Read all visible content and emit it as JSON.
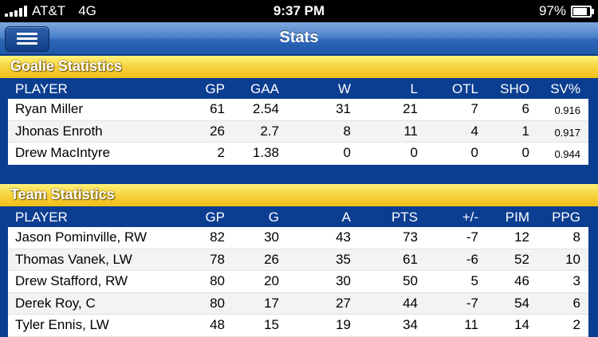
{
  "status": {
    "carrier": "AT&T",
    "network": "4G",
    "time": "9:37 PM",
    "battery": "97%",
    "battery_level": 0.97
  },
  "nav": {
    "title": "Stats",
    "menu_icon": "hamburger-icon"
  },
  "goalie": {
    "title": "Goalie Statistics",
    "headers": [
      "PLAYER",
      "GP",
      "GAA",
      "W",
      "L",
      "OTL",
      "SHO",
      "SV%"
    ],
    "rows": [
      [
        "Ryan Miller",
        "61",
        "2.54",
        "31",
        "21",
        "7",
        "6",
        "0.916"
      ],
      [
        "Jhonas Enroth",
        "26",
        "2.7",
        "8",
        "11",
        "4",
        "1",
        "0.917"
      ],
      [
        "Drew MacIntyre",
        "2",
        "1.38",
        "0",
        "0",
        "0",
        "0",
        "0.944"
      ]
    ]
  },
  "team": {
    "title": "Team Statistics",
    "headers": [
      "PLAYER",
      "GP",
      "G",
      "A",
      "PTS",
      "+/-",
      "PIM",
      "PPG"
    ],
    "rows": [
      [
        "Jason Pominville, RW",
        "82",
        "30",
        "43",
        "73",
        "-7",
        "12",
        "8"
      ],
      [
        "Thomas Vanek, LW",
        "78",
        "26",
        "35",
        "61",
        "-6",
        "52",
        "10"
      ],
      [
        "Drew Stafford, RW",
        "80",
        "20",
        "30",
        "50",
        "5",
        "46",
        "3"
      ],
      [
        "Derek Roy, C",
        "80",
        "17",
        "27",
        "44",
        "-7",
        "54",
        "6"
      ],
      [
        "Tyler Ennis, LW",
        "48",
        "15",
        "19",
        "34",
        "11",
        "14",
        "2"
      ]
    ]
  },
  "colors": {
    "table_header": "#0b3e91",
    "section_yellow": "#f7d23e",
    "nav_blue": "#2f66b8"
  }
}
